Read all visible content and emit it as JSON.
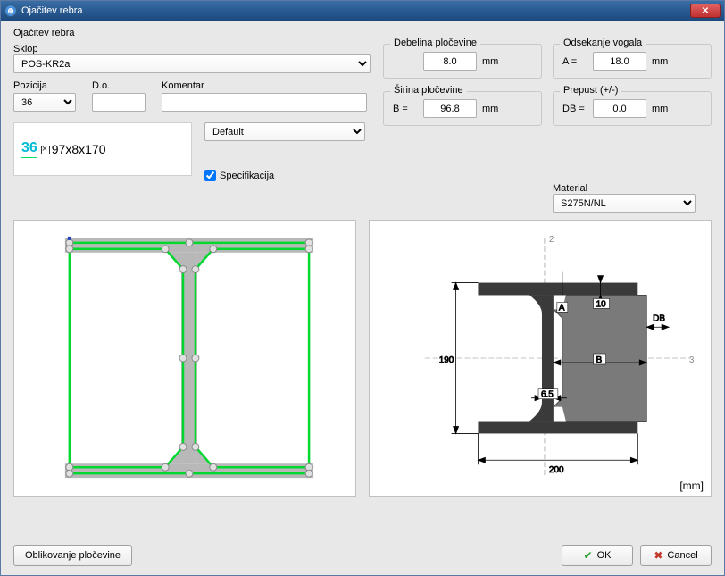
{
  "window": {
    "title": "Ojačitev rebra",
    "section_label": "Ojačitev rebra"
  },
  "sklop": {
    "label": "Sklop",
    "value": "POS-KR2a"
  },
  "pozicija": {
    "label": "Pozicija",
    "value": "36"
  },
  "do": {
    "label": "D.o.",
    "value": ""
  },
  "komentar": {
    "label": "Komentar",
    "value": ""
  },
  "preview_combo": "Default",
  "spec": {
    "number": "36",
    "text": "97x8x170",
    "checkbox_label": "Specifikacija",
    "checked": true
  },
  "debelina": {
    "legend": "Debelina pločevine",
    "value": "8.0",
    "unit": "mm"
  },
  "sirina": {
    "legend": "Širina pločevine",
    "prefix": "B =",
    "value": "96.8",
    "unit": "mm"
  },
  "odsekanje": {
    "legend": "Odsekanje vogala",
    "prefix": "A =",
    "value": "18.0",
    "unit": "mm"
  },
  "prepust": {
    "legend": "Prepust (+/-)",
    "prefix": "DB =",
    "value": "0.0",
    "unit": "mm"
  },
  "material": {
    "label": "Material",
    "value": "S275N/NL"
  },
  "diagram": {
    "height_label": "190",
    "width_label": "200",
    "B_label": "B",
    "DB_label": "DB",
    "A_label": "A",
    "dim1": "10",
    "dim2": "6.5",
    "axis2": "2",
    "axis3": "3",
    "unit": "[mm]"
  },
  "buttons": {
    "shape": "Oblikovanje pločevine",
    "ok": "OK",
    "cancel": "Cancel"
  }
}
